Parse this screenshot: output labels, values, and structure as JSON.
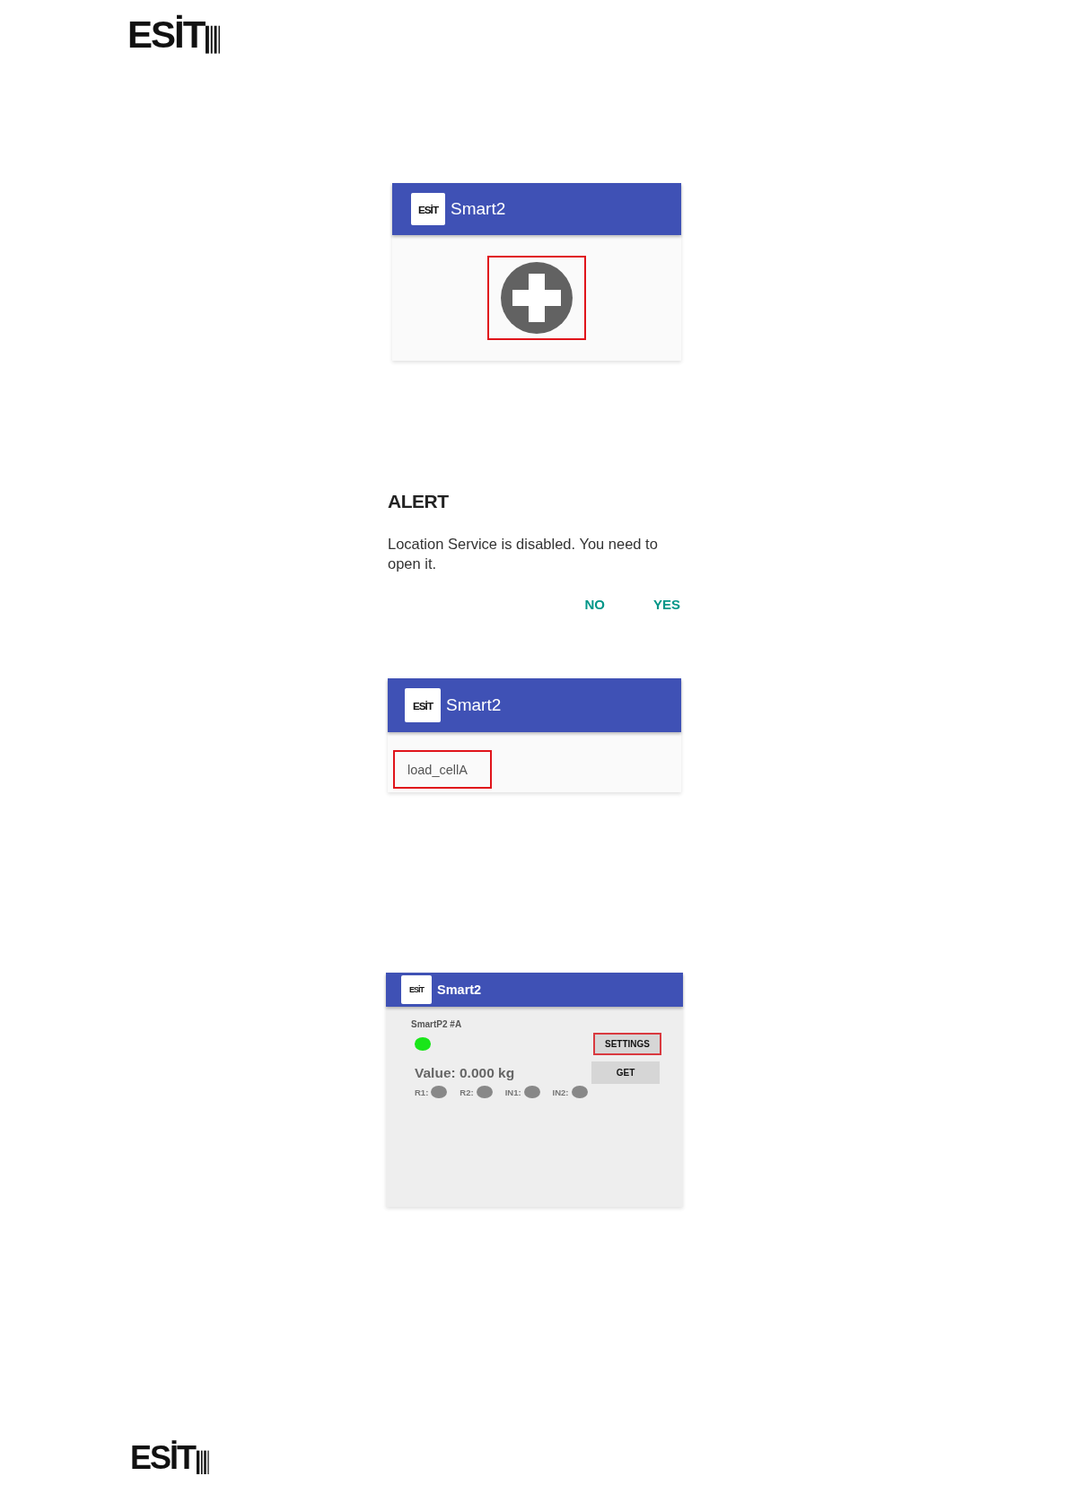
{
  "header_logo": {
    "text": "ESİT"
  },
  "add_screen": {
    "app_bar": {
      "logo": "ESİT",
      "title": "Smart2"
    },
    "add_button": {
      "highlighted": true
    }
  },
  "alert": {
    "title": "ALERT",
    "message": "Location Service is disabled. You need to open it.",
    "buttons": [
      "NO",
      "YES"
    ]
  },
  "device_list_screen": {
    "app_bar": {
      "logo": "ESİT",
      "title": "Smart2"
    },
    "devices": [
      {
        "name": "load_cellA",
        "highlighted": true
      }
    ]
  },
  "device_screen": {
    "app_bar": {
      "logo": "ESİT",
      "title": "Smart2"
    },
    "device_name": "SmartP2 #A",
    "connected": true,
    "settings_button": {
      "label": "SETTINGS",
      "highlighted": true
    },
    "value": "Value: 0.000 kg",
    "get_button": {
      "label": "GET",
      "highlighted": false
    },
    "indicators": [
      {
        "label": "R1:",
        "on": false
      },
      {
        "label": "R2:",
        "on": false
      },
      {
        "label": "IN1:",
        "on": false
      },
      {
        "label": "IN2:",
        "on": false
      }
    ]
  },
  "footer_logo": {
    "text": "ESİT"
  }
}
